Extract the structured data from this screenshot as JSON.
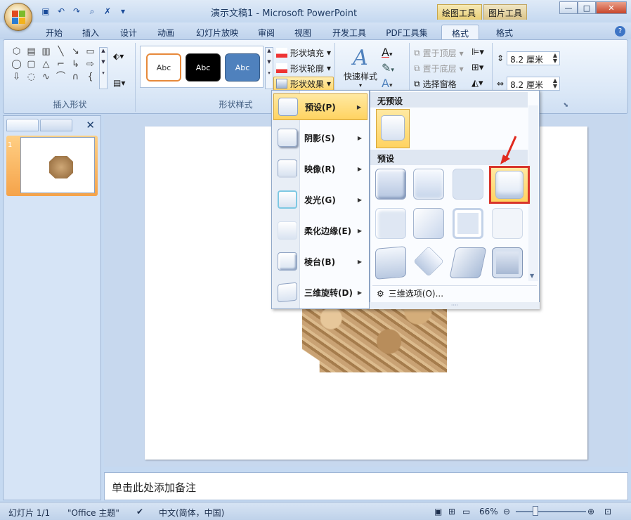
{
  "titlebar": {
    "title": "演示文稿1 - Microsoft PowerPoint",
    "context_draw": "绘图工具",
    "context_picture": "图片工具",
    "qat_icons": [
      "save-icon",
      "undo-icon",
      "redo-icon",
      "print-preview-icon",
      "spelling-icon",
      "customize-icon"
    ]
  },
  "tabs": [
    "开始",
    "插入",
    "设计",
    "动画",
    "幻灯片放映",
    "审阅",
    "视图",
    "开发工具",
    "PDF工具集",
    "格式",
    "格式"
  ],
  "ribbon": {
    "group_insert_shapes": "插入形状",
    "group_shape_styles": "形状样式",
    "style_samples": [
      "Abc",
      "Abc",
      "Abc"
    ],
    "shape_fill": "形状填充",
    "shape_outline": "形状轮廓",
    "shape_effects": "形状效果",
    "quick_styles": "快速样式",
    "bring_front": "置于顶层",
    "send_back": "置于底层",
    "selection_pane": "选择窗格",
    "height_value": "8.2 厘米",
    "width_value": "8.2 厘米"
  },
  "effects_menu": [
    {
      "label": "预设(P)",
      "active": true
    },
    {
      "label": "阴影(S)",
      "active": false
    },
    {
      "label": "映像(R)",
      "active": false
    },
    {
      "label": "发光(G)",
      "active": false
    },
    {
      "label": "柔化边缘(E)",
      "active": false
    },
    {
      "label": "棱台(B)",
      "active": false
    },
    {
      "label": "三维旋转(D)",
      "active": false
    }
  ],
  "preset_panel": {
    "no_preset_heading": "无预设",
    "preset_heading": "预设",
    "three_d_options": "三维选项(O)..."
  },
  "slides_pane": {
    "slide_number": "1"
  },
  "notes_placeholder": "单击此处添加备注",
  "statusbar": {
    "slide_info": "幻灯片 1/1",
    "theme": "\"Office 主题\"",
    "language": "中文(简体，中国)",
    "zoom": "66%"
  },
  "colors": {
    "accent_selected": "#ffd361",
    "highlight_red": "#d8352b"
  }
}
